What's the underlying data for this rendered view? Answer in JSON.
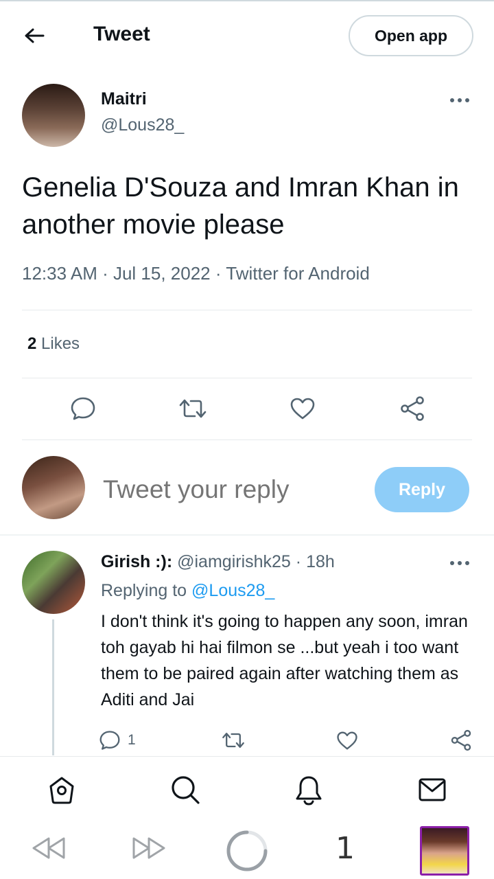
{
  "header": {
    "title": "Tweet",
    "open_app_label": "Open app"
  },
  "tweet": {
    "author_name": "Maitri",
    "author_handle": "@Lous28_",
    "text": "Genelia D'Souza and Imran Khan in another movie please",
    "meta": "12:33 AM · Jul 15, 2022 · Twitter for Android",
    "likes_count": "2",
    "likes_label": "Likes"
  },
  "composer": {
    "placeholder": "Tweet your reply",
    "reply_label": "Reply"
  },
  "reply": {
    "author_name": "Girish :):",
    "author_handle": "@iamgirishk25",
    "separator": "·",
    "time": "18h",
    "replying_to_label": "Replying to",
    "replying_to_handle": "@Lous28_",
    "text": "I don't think it's going to happen any soon, imran toh gayab hi hai filmon se ...but yeah i too want them to be paired again after watching them as Aditi and Jai",
    "reply_count": "1"
  },
  "browser": {
    "tab_count": "1"
  },
  "colors": {
    "accent": "#1d9bf0",
    "reply_button_disabled": "#8ecdf8",
    "secondary_text": "#536471",
    "tab_border": "#8b1fa8"
  },
  "icons": [
    "back-arrow-icon",
    "more-icon",
    "comment-icon",
    "retweet-icon",
    "heart-icon",
    "share-icon",
    "home-icon",
    "search-icon",
    "bell-icon",
    "mail-icon",
    "rewind-icon",
    "fast-forward-icon",
    "loading-icon"
  ]
}
